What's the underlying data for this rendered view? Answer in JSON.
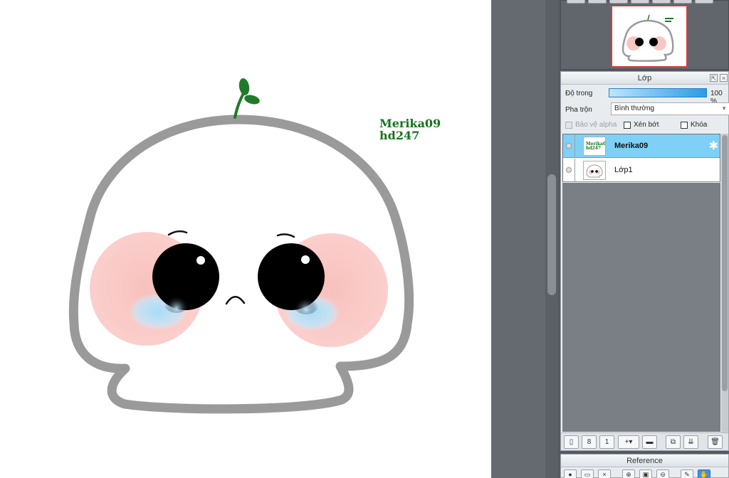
{
  "canvas": {
    "signature_line1": "Merika09",
    "signature_line2": "hd247"
  },
  "layer_panel": {
    "title": "Lớp",
    "opacity_label": "Độ trong",
    "opacity_value": "100 %",
    "opacity_fraction": 1.0,
    "blend_label": "Pha trộn",
    "blend_value": "Bình thường",
    "protect_alpha": "Bảo vệ alpha",
    "clipping": "Xén bớt",
    "lock": "Khóa",
    "layers": [
      {
        "name": "Merika09",
        "active": true,
        "thumb_text": "Merika09 hd247"
      },
      {
        "name": "Lớp1",
        "active": false
      }
    ]
  },
  "reference_panel": {
    "title": "Reference"
  },
  "colors": {
    "accent": "#7fd0f7",
    "canvas_bg": "#ffffff",
    "workspace": "#656970",
    "outline": "#9a9a9a",
    "blush": "#f8c7c3",
    "tear": "#a7dcf7",
    "sprout": "#1f7a2a",
    "signature": "#15731f"
  },
  "icons": {
    "gear": "gear-icon",
    "close": "close-icon",
    "pin": "pin-icon",
    "new_layer": "new-layer-icon",
    "delete": "trash-icon",
    "hand": "hand-icon"
  }
}
